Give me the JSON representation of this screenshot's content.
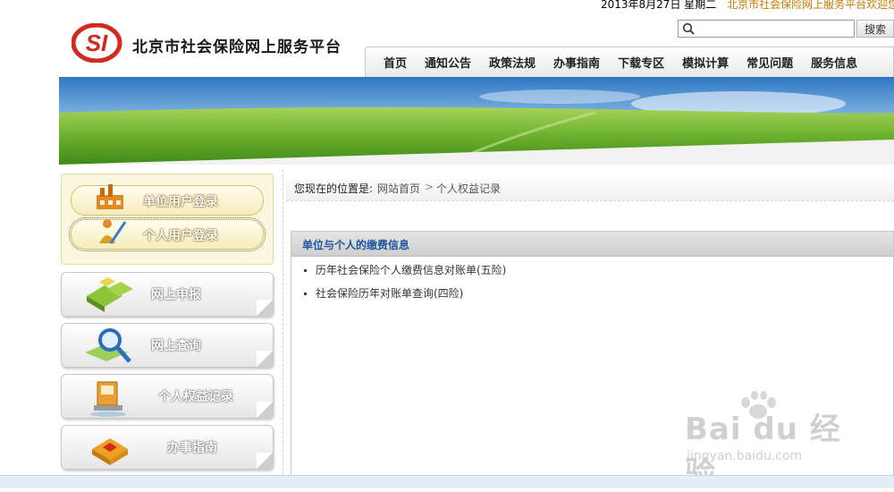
{
  "top": {
    "date": "2013年8月27日 星期二",
    "marquee": "北京市社会保险网上服务平台欢迎您!"
  },
  "header": {
    "logo_text": "SI",
    "site_name": "北京市社会保险网上服务平台",
    "search": {
      "placeholder": "",
      "button_label": "搜索"
    },
    "nav": [
      "首页",
      "通知公告",
      "政策法规",
      "办事指南",
      "下载专区",
      "模拟计算",
      "常见问题",
      "服务信息"
    ]
  },
  "sidebar": {
    "login_unit": "单位用户登录",
    "login_person": "个人用户登录",
    "menu": [
      {
        "label": "网上申报",
        "icon": "office-buildings-icon"
      },
      {
        "label": "网上查询",
        "icon": "magnifier-icon"
      },
      {
        "label": "个人权益记录",
        "icon": "computer-icon"
      },
      {
        "label": "办事指南",
        "icon": "guide-box-icon"
      }
    ]
  },
  "breadcrumb": {
    "label": "您现在的位置是:",
    "home": "网站首页",
    "separator": ">",
    "current": "个人权益记录"
  },
  "content": {
    "title": "单位与个人的缴费信息",
    "links": [
      "历年社会保险个人缴费信息对账单(五险)",
      "社会保险历年对账单查询(四险)"
    ]
  },
  "watermark": {
    "brand": "Bai du 经验",
    "url": "jingyan.baidu.com"
  },
  "colors": {
    "accent_blue": "#1e56a0",
    "logo_red": "#d12a1e",
    "marquee_orange": "#c47a00"
  }
}
